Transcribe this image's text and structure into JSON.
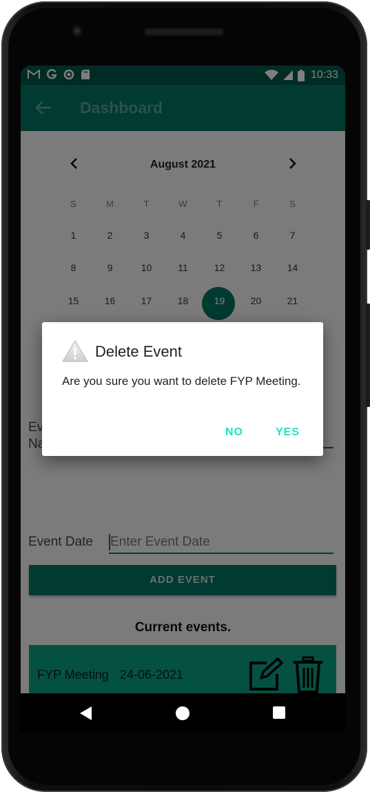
{
  "status_bar": {
    "notification_icons": [
      "gmail-icon",
      "google-icon",
      "circle-icon",
      "sd-card-icon"
    ],
    "system_icons": [
      "wifi-icon",
      "cell-signal-icon",
      "battery-icon"
    ],
    "time": "10:33"
  },
  "app_bar": {
    "back_icon": "back-arrow-icon",
    "title": "Dashboard"
  },
  "calendar": {
    "month_label": "August 2021",
    "weekdays": [
      "S",
      "M",
      "T",
      "W",
      "T",
      "F",
      "S"
    ],
    "weeks": [
      [
        "1",
        "2",
        "3",
        "4",
        "5",
        "6",
        "7"
      ],
      [
        "8",
        "9",
        "10",
        "11",
        "12",
        "13",
        "14"
      ],
      [
        "15",
        "16",
        "17",
        "18",
        "19",
        "20",
        "21"
      ]
    ],
    "selected_day": "19"
  },
  "form": {
    "event_name_label_partial": "Ev",
    "event_name_label_partial2": "Na",
    "event_date_label": "Event Date",
    "event_date_placeholder": "Enter Event Date",
    "add_button": "ADD EVENT"
  },
  "events": {
    "heading": "Current events.",
    "items": [
      {
        "name": "FYP Meeting",
        "date": "24-06-2021"
      }
    ]
  },
  "dialog": {
    "title": "Delete Event",
    "message": "Are you sure you want to delete FYP Meeting.",
    "no_button": "NO",
    "yes_button": "YES",
    "icon": "warning-icon"
  },
  "colors": {
    "primary": "#037461",
    "status_bar": "#02574a",
    "event_card": "#0aa383",
    "dialog_button": "#1ee3c0"
  }
}
